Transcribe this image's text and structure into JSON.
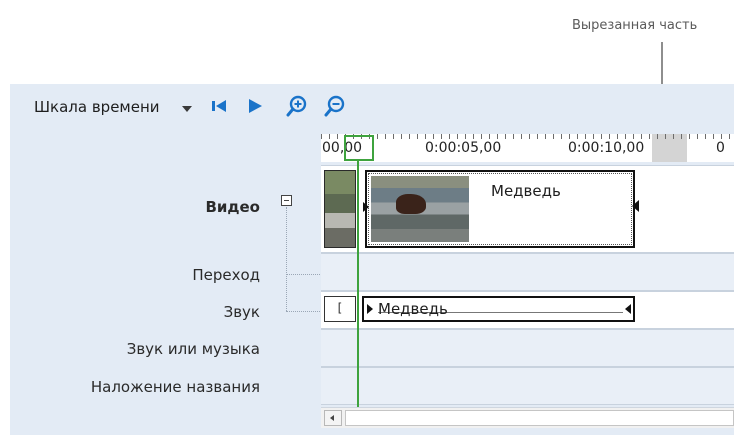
{
  "callout": {
    "label": "Вырезанная часть"
  },
  "toolbar": {
    "timeline_label": "Шкала времени"
  },
  "ruler": {
    "labels": [
      "00,00",
      "0:00:05,00",
      "0:00:10,00",
      "0"
    ]
  },
  "tracks": {
    "video": "Видео",
    "transition": "Переход",
    "audio": "Звук",
    "music": "Звук или музыка",
    "title_overlay": "Наложение названия"
  },
  "clips": {
    "video_title": "Медведь",
    "audio_title": "Медведь",
    "audio_small_marker": "["
  },
  "colors": {
    "accent": "#3ea33e",
    "panel": "#e3ebf5",
    "play_blue": "#1a73c9"
  }
}
